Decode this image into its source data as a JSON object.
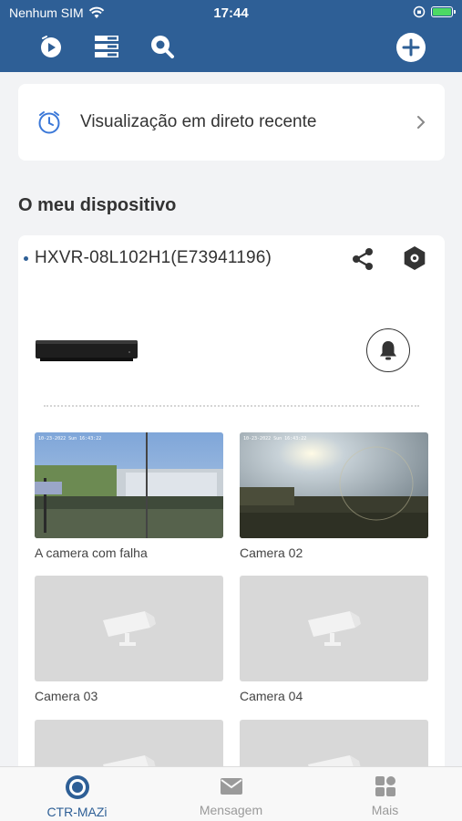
{
  "status_bar": {
    "carrier": "Nenhum SIM",
    "time": "17:44"
  },
  "colors": {
    "header": "#2e5f96",
    "accent": "#2e5f96",
    "tab_inactive": "#9a9a9a"
  },
  "toolbar": {
    "icons": [
      "playback-icon",
      "device-list-icon",
      "search-icon",
      "add-icon"
    ]
  },
  "recent": {
    "label": "Visualização em direto recente"
  },
  "section": {
    "title": "O meu dispositivo"
  },
  "device": {
    "name": "HXVR-08L102H1(E73941196)",
    "cameras": [
      {
        "name": "A camera com falha",
        "has_preview": true
      },
      {
        "name": "Camera 02",
        "has_preview": true
      },
      {
        "name": "Camera 03",
        "has_preview": false
      },
      {
        "name": "Camera 04",
        "has_preview": false
      },
      {
        "name": "",
        "has_preview": false
      },
      {
        "name": "",
        "has_preview": false
      }
    ]
  },
  "tabbar": {
    "tabs": [
      {
        "label": "CTR-MAZi",
        "icon": "live-view-icon",
        "active": true
      },
      {
        "label": "Mensagem",
        "icon": "envelope-icon",
        "active": false
      },
      {
        "label": "Mais",
        "icon": "grid-icon",
        "active": false
      }
    ]
  }
}
